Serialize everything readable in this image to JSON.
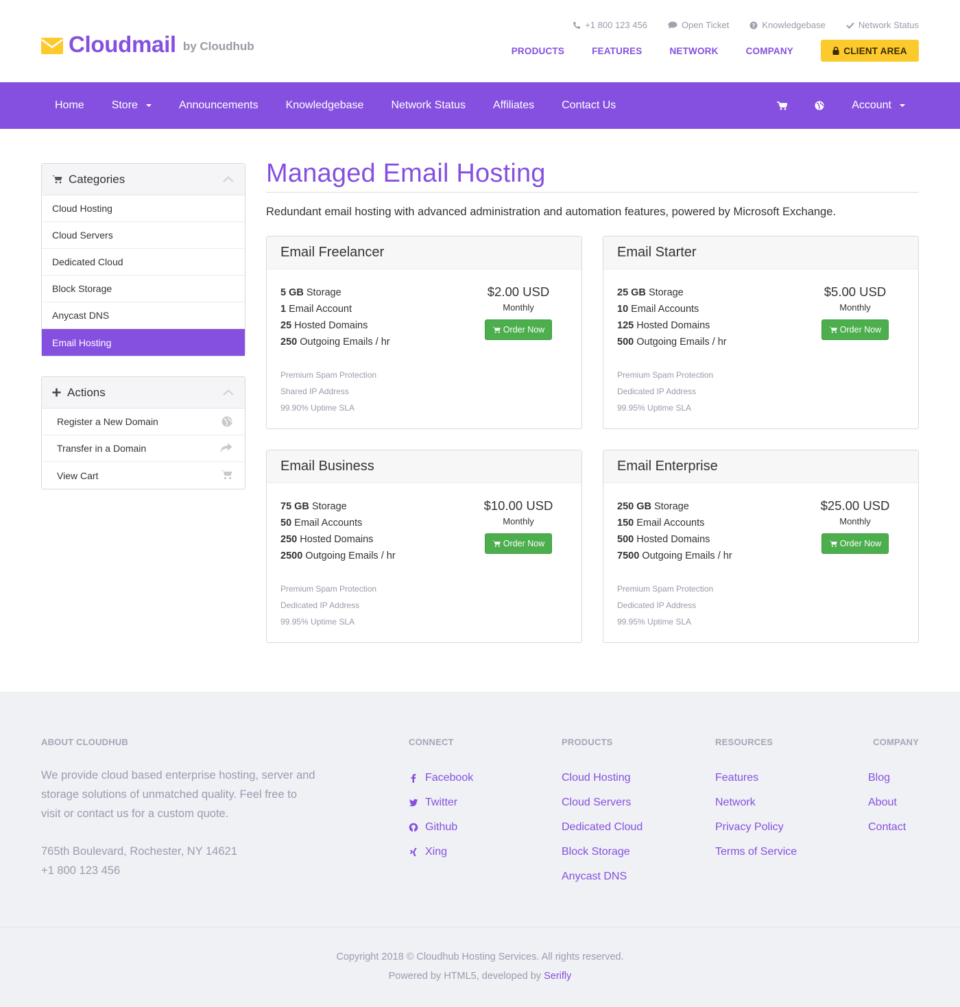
{
  "brand": {
    "name": "Cloudmail",
    "byline": "by Cloudhub",
    "accent": "#8550e0",
    "yellow": "#fcca2c",
    "green": "#4cae4c"
  },
  "top_links": [
    {
      "label": "+1 800 123 456",
      "icon": "phone-icon"
    },
    {
      "label": "Open Ticket",
      "icon": "comment-icon"
    },
    {
      "label": "Knowledgebase",
      "icon": "question-icon"
    },
    {
      "label": "Network Status",
      "icon": "check-icon"
    }
  ],
  "main_links": [
    "PRODUCTS",
    "FEATURES",
    "NETWORK",
    "COMPANY"
  ],
  "client_area": "CLIENT AREA",
  "nav": {
    "home": "Home",
    "store": "Store",
    "announcements": "Announcements",
    "knowledgebase": "Knowledgebase",
    "network_status": "Network Status",
    "affiliates": "Affiliates",
    "contact": "Contact Us",
    "account": "Account"
  },
  "sidebar": {
    "categories_title": "Categories",
    "categories": [
      "Cloud Hosting",
      "Cloud Servers",
      "Dedicated Cloud",
      "Block Storage",
      "Anycast DNS",
      "Email Hosting"
    ],
    "active_category": "Email Hosting",
    "actions_title": "Actions",
    "actions": [
      {
        "label": "Register a New Domain",
        "icon": "globe-icon"
      },
      {
        "label": "Transfer in a Domain",
        "icon": "share-icon"
      },
      {
        "label": "View Cart",
        "icon": "cart-icon"
      }
    ]
  },
  "main": {
    "title": "Managed Email Hosting",
    "tagline": "Redundant email hosting with advanced administration and automation features, powered by Microsoft Exchange."
  },
  "products": [
    {
      "name": "Email Freelancer",
      "features": [
        {
          "value": "5 GB",
          "label": "Storage"
        },
        {
          "value": "1",
          "label": "Email Account"
        },
        {
          "value": "25",
          "label": "Hosted Domains"
        },
        {
          "value": "250",
          "label": "Outgoing Emails / hr"
        }
      ],
      "extras": [
        "Premium Spam Protection",
        "Shared IP Address",
        "99.90% Uptime SLA"
      ],
      "price": "$2.00 USD",
      "cycle": "Monthly",
      "button": "Order Now"
    },
    {
      "name": "Email Starter",
      "features": [
        {
          "value": "25 GB",
          "label": "Storage"
        },
        {
          "value": "10",
          "label": "Email Accounts"
        },
        {
          "value": "125",
          "label": "Hosted Domains"
        },
        {
          "value": "500",
          "label": "Outgoing Emails / hr"
        }
      ],
      "extras": [
        "Premium Spam Protection",
        "Dedicated IP Address",
        "99.95% Uptime SLA"
      ],
      "price": "$5.00 USD",
      "cycle": "Monthly",
      "button": "Order Now"
    },
    {
      "name": "Email Business",
      "features": [
        {
          "value": "75 GB",
          "label": "Storage"
        },
        {
          "value": "50",
          "label": "Email Accounts"
        },
        {
          "value": "250",
          "label": "Hosted Domains"
        },
        {
          "value": "2500",
          "label": "Outgoing Emails / hr"
        }
      ],
      "extras": [
        "Premium Spam Protection",
        "Dedicated IP Address",
        "99.95% Uptime SLA"
      ],
      "price": "$10.00 USD",
      "cycle": "Monthly",
      "button": "Order Now"
    },
    {
      "name": "Email Enterprise",
      "features": [
        {
          "value": "250 GB",
          "label": "Storage"
        },
        {
          "value": "150",
          "label": "Email Accounts"
        },
        {
          "value": "500",
          "label": "Hosted Domains"
        },
        {
          "value": "7500",
          "label": "Outgoing Emails / hr"
        }
      ],
      "extras": [
        "Premium Spam Protection",
        "Dedicated IP Address",
        "99.95% Uptime SLA"
      ],
      "price": "$25.00 USD",
      "cycle": "Monthly",
      "button": "Order Now"
    }
  ],
  "footer": {
    "about_title": "ABOUT CLOUDHUB",
    "about_text": "We provide cloud based enterprise hosting, server and storage solutions of unmatched quality. Feel free to visit or contact us for a custom quote.",
    "address": "765th Boulevard, Rochester, NY 14621",
    "phone": "+1 800 123 456",
    "connect_title": "CONNECT",
    "connect": [
      {
        "label": "Facebook",
        "icon": "facebook-icon"
      },
      {
        "label": "Twitter",
        "icon": "twitter-icon"
      },
      {
        "label": "Github",
        "icon": "github-icon"
      },
      {
        "label": "Xing",
        "icon": "xing-icon"
      }
    ],
    "products_title": "PRODUCTS",
    "products": [
      "Cloud Hosting",
      "Cloud Servers",
      "Dedicated Cloud",
      "Block Storage",
      "Anycast DNS"
    ],
    "resources_title": "RESOURCES",
    "resources": [
      "Features",
      "Network",
      "Privacy Policy",
      "Terms of Service"
    ],
    "company_title": "COMPANY",
    "company": [
      "Blog",
      "About",
      "Contact"
    ],
    "copyright": "Copyright 2018 © Cloudhub Hosting Services. All rights reserved.",
    "powered_prefix": "Powered by HTML5, developed by",
    "powered_brand": "Serifly"
  }
}
